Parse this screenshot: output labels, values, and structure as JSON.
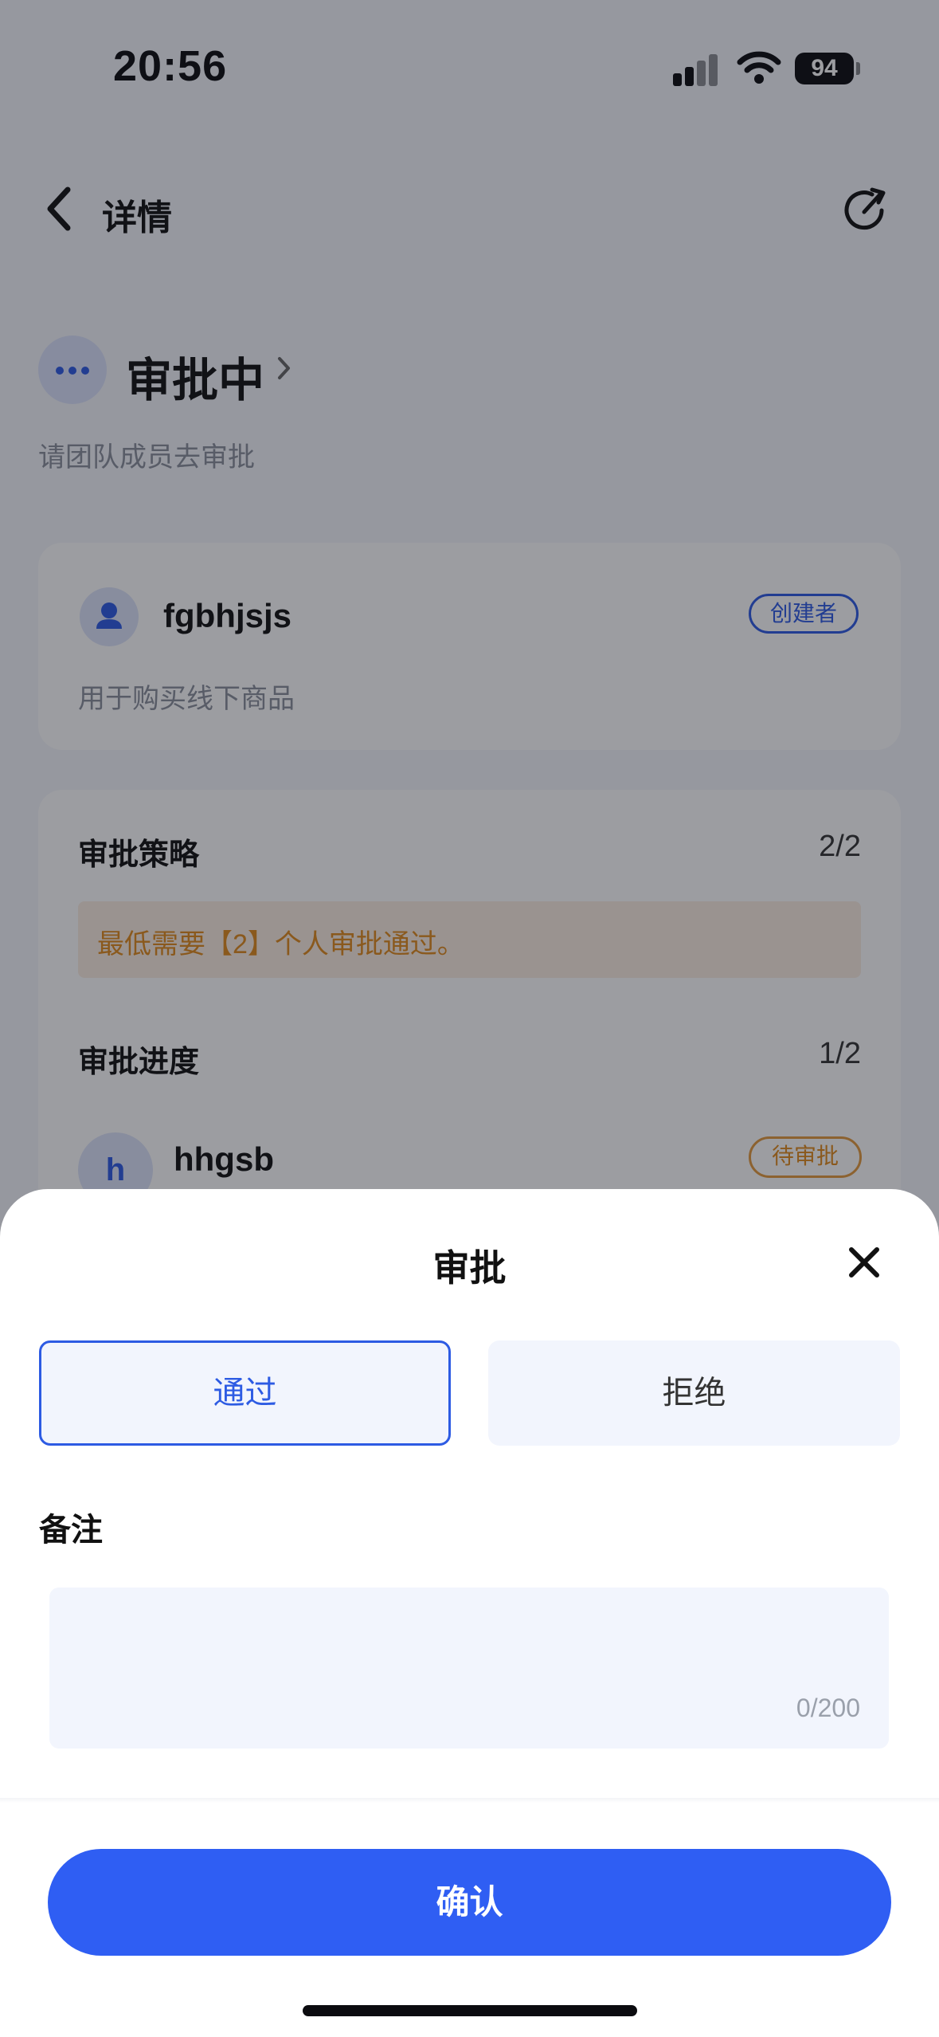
{
  "status_bar": {
    "time": "20:56",
    "battery": "94"
  },
  "header": {
    "title": "详情"
  },
  "approval_status": {
    "title": "审批中",
    "subtitle": "请团队成员去审批"
  },
  "creator_card": {
    "name": "fgbhjsjs",
    "badge": "创建者",
    "description": "用于购买线下商品"
  },
  "policy": {
    "label": "审批策略",
    "value": "2/2",
    "note": "最低需要【2】个人审批通过。"
  },
  "progress": {
    "label": "审批进度",
    "value": "1/2"
  },
  "approvers": [
    {
      "initial": "h",
      "name": "hhgsb",
      "status": "待审批"
    }
  ],
  "sheet": {
    "title": "审批",
    "options": {
      "pass": "通过",
      "reject": "拒绝"
    },
    "remark_label": "备注",
    "remark_value": "",
    "remark_count": "0/200",
    "confirm_label": "确认"
  },
  "colors": {
    "accent": "#2F5EF3",
    "pending": "#E08A1D"
  }
}
